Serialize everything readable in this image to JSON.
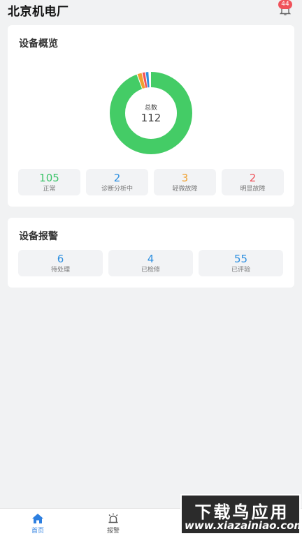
{
  "header": {
    "title": "北京机电厂",
    "notification_count": "44"
  },
  "overview": {
    "title": "设备概览",
    "donut": {
      "center_label": "总数",
      "center_value": "112",
      "colors": [
        "#44cc66",
        "#f0a030",
        "#f0525a",
        "#2d8fe0"
      ]
    },
    "stats": [
      {
        "value": "105",
        "label": "正常",
        "color": "#3cc46a"
      },
      {
        "value": "2",
        "label": "诊断分析中",
        "color": "#2d8fe0"
      },
      {
        "value": "3",
        "label": "轻微故障",
        "color": "#f0a030"
      },
      {
        "value": "2",
        "label": "明显故障",
        "color": "#f0525a"
      }
    ]
  },
  "alarms": {
    "title": "设备报警",
    "stats": [
      {
        "value": "6",
        "label": "待处理",
        "color": "#2d8fe0"
      },
      {
        "value": "4",
        "label": "已检修",
        "color": "#2d8fe0"
      },
      {
        "value": "55",
        "label": "已评验",
        "color": "#2d8fe0"
      }
    ]
  },
  "tabbar": {
    "items": [
      {
        "label": "首页",
        "icon": "home-icon",
        "active": true
      },
      {
        "label": "报警",
        "icon": "alarm-light-icon",
        "active": false
      }
    ],
    "active_color": "#2d7fe0",
    "inactive_color": "#555555"
  },
  "watermark": {
    "main": "下载鸟应用",
    "url": "www.xiazainiao.com"
  }
}
